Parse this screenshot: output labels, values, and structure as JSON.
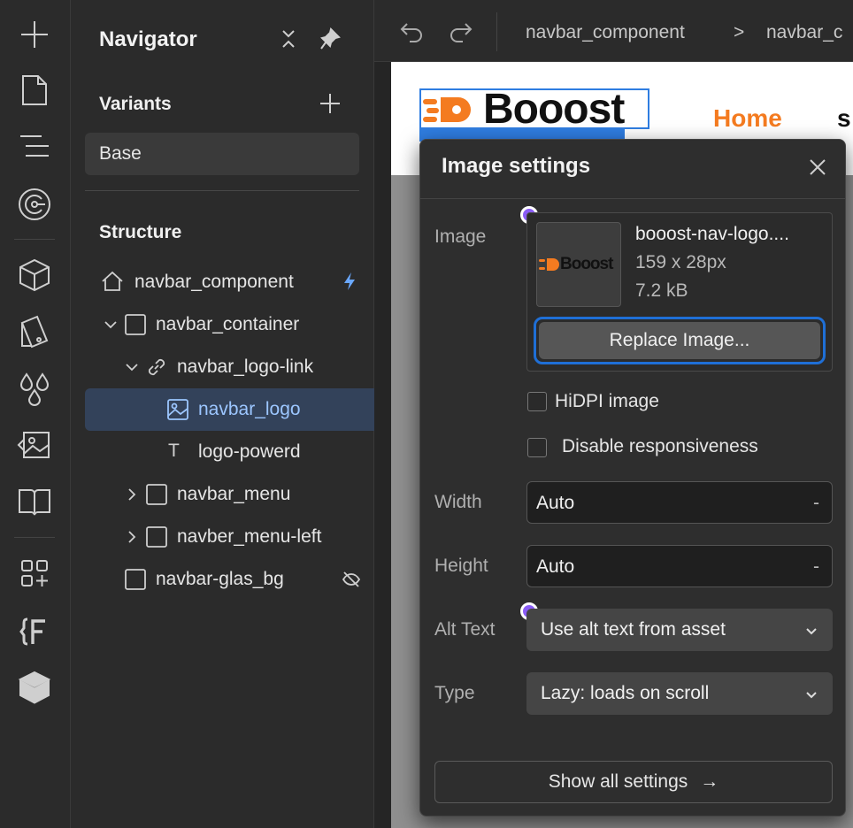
{
  "rail": {
    "icons": [
      "add-icon",
      "page-icon",
      "navigator-icon",
      "components-icon",
      "assets-cube-icon",
      "styles-icon",
      "color-drops-icon",
      "image-assets-icon",
      "book-icon",
      "apps-icon",
      "variables-icon",
      "box-icon"
    ]
  },
  "navigator": {
    "title": "Navigator",
    "variants_heading": "Variants",
    "base_label": "Base",
    "structure_heading": "Structure",
    "tree": [
      {
        "label": "navbar_component"
      },
      {
        "label": "navbar_container"
      },
      {
        "label": "navbar_logo-link"
      },
      {
        "label": "navbar_logo"
      },
      {
        "label": "logo-powerd"
      },
      {
        "label": "navbar_menu"
      },
      {
        "label": "navber_menu-left"
      },
      {
        "label": "navbar-glas_bg"
      }
    ]
  },
  "topbar": {
    "crumb1": "navbar_component",
    "crumb_sep": ">",
    "crumb2": "navbar_c"
  },
  "preview": {
    "logo_text": "Booost",
    "home_link": "Home",
    "next_link_partial": "s"
  },
  "image_settings": {
    "title": "Image settings",
    "image_label": "Image",
    "thumb_logo_text": "Booost",
    "file_name": "booost-nav-logo....",
    "dimensions": "159 x 28px",
    "file_size": "7.2 kB",
    "replace_label": "Replace Image...",
    "hidpi_label": "HiDPI image",
    "hidpi_checked": false,
    "disable_responsive_label": "Disable responsiveness",
    "disable_responsive_checked": false,
    "width_label": "Width",
    "width_value": "Auto",
    "width_unit": "-",
    "height_label": "Height",
    "height_value": "Auto",
    "height_unit": "-",
    "alt_label": "Alt Text",
    "alt_value": "Use alt text from asset",
    "type_label": "Type",
    "type_value": "Lazy: loads on scroll",
    "show_all_label": "Show all settings",
    "show_all_arrow": "→"
  },
  "colors": {
    "accent": "#2f7de1",
    "brand_orange": "#f47b20",
    "modified_dot": "#8a5cf6",
    "selected_row": "#33425a"
  }
}
